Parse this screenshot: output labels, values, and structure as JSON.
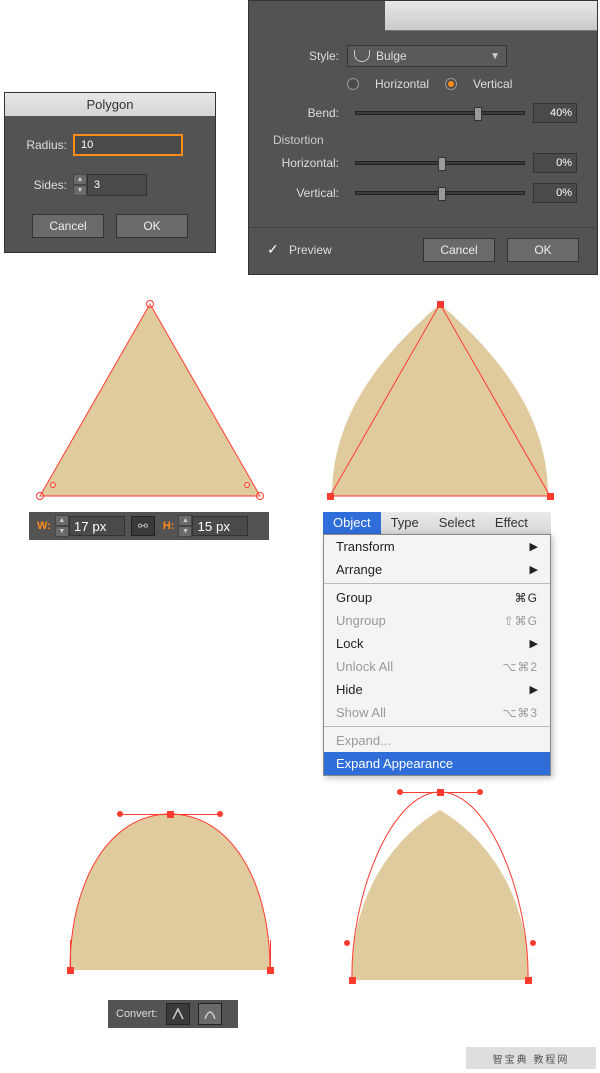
{
  "polygon": {
    "title": "Polygon",
    "radius_label": "Radius:",
    "radius_value": "10",
    "sides_label": "Sides:",
    "sides_value": "3",
    "cancel": "Cancel",
    "ok": "OK"
  },
  "warp": {
    "style_label": "Style:",
    "style_value": "Bulge",
    "horizontal_label": "Horizontal",
    "vertical_label": "Vertical",
    "orientation": "Vertical",
    "bend_label": "Bend:",
    "bend_value": "40%",
    "distortion_label": "Distortion",
    "dist_h_label": "Horizontal:",
    "dist_h_value": "0%",
    "dist_v_label": "Vertical:",
    "dist_v_value": "0%",
    "preview_label": "Preview",
    "preview_checked": true,
    "cancel": "Cancel",
    "ok": "OK"
  },
  "transform_bar": {
    "w_label": "W:",
    "w_value": "17 px",
    "h_label": "H:",
    "h_value": "15 px",
    "link_icon": "link-icon"
  },
  "menu": {
    "items": [
      "Object",
      "Type",
      "Select",
      "Effect"
    ],
    "active": "Object",
    "dropdown": [
      {
        "label": "Transform",
        "arrow": true
      },
      {
        "label": "Arrange",
        "arrow": true
      },
      {
        "sep": true
      },
      {
        "label": "Group",
        "shortcut": "⌘G"
      },
      {
        "label": "Ungroup",
        "shortcut": "⇧⌘G",
        "disabled": true
      },
      {
        "label": "Lock",
        "arrow": true
      },
      {
        "label": "Unlock All",
        "shortcut": "⌥⌘2",
        "disabled": true
      },
      {
        "label": "Hide",
        "arrow": true
      },
      {
        "label": "Show All",
        "shortcut": "⌥⌘3",
        "disabled": true
      },
      {
        "sep": true
      },
      {
        "label": "Expand...",
        "disabled": true
      },
      {
        "label": "Expand Appearance",
        "highlight": true
      }
    ]
  },
  "convert": {
    "label": "Convert:"
  },
  "shapes": {
    "fill": "#dfcb9d"
  },
  "watermark": "智宝典  教程网"
}
